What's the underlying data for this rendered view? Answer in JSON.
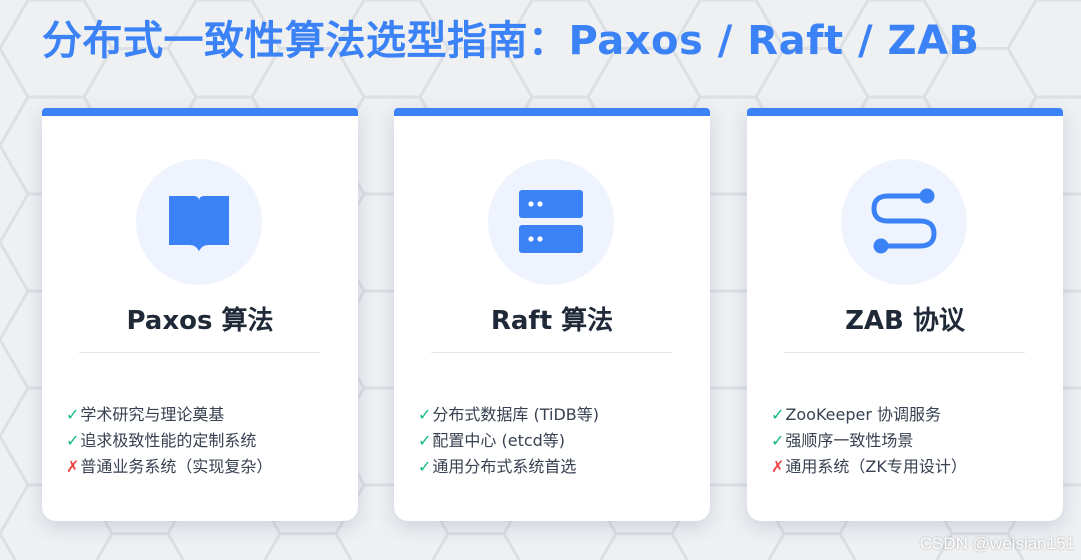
{
  "header": {
    "title": "分布式一致性算法选型指南：Paxos / Raft / ZAB"
  },
  "theme": {
    "accent": "#3b82f6",
    "check_color": "#10b981",
    "cross_color": "#ef4444"
  },
  "cards": [
    {
      "icon": "book-icon",
      "title": "Paxos 算法",
      "features": [
        {
          "mark": "✓",
          "type": "check",
          "text": "学术研究与理论奠基"
        },
        {
          "mark": "✓",
          "type": "check",
          "text": "追求极致性能的定制系统"
        },
        {
          "mark": "✗",
          "type": "cross",
          "text": "普通业务系统（实现复杂）"
        }
      ]
    },
    {
      "icon": "server-icon",
      "title": "Raft 算法",
      "features": [
        {
          "mark": "✓",
          "type": "check",
          "text": "分布式数据库 (TiDB等)"
        },
        {
          "mark": "✓",
          "type": "check",
          "text": "配置中心 (etcd等)"
        },
        {
          "mark": "✓",
          "type": "check",
          "text": "通用分布式系统首选"
        }
      ]
    },
    {
      "icon": "route-icon",
      "title": "ZAB 协议",
      "features": [
        {
          "mark": "✓",
          "type": "check",
          "text": "ZooKeeper 协调服务"
        },
        {
          "mark": "✓",
          "type": "check",
          "text": "强顺序一致性场景"
        },
        {
          "mark": "✗",
          "type": "cross",
          "text": "通用系统（ZK专用设计）"
        }
      ]
    }
  ],
  "watermark": {
    "text": "CSDN @weisian151"
  }
}
